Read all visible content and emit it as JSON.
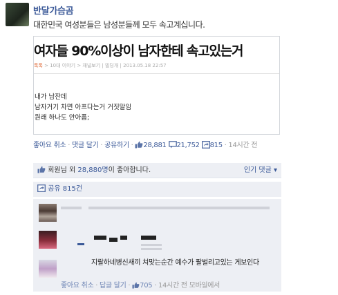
{
  "post": {
    "author": "반달가슴곰",
    "text": "대한민국 여성분들은 남성분들께 모두 속고계십니다."
  },
  "shared": {
    "headline": "여자들 90%이상이 남자한테 속고있는거",
    "crumb": [
      "톡톡",
      " > 10대 이야기 > ",
      "채널보기",
      " | 빌딩개 | 2013.05.18 22:57"
    ],
    "body": [
      "내가 남잔데",
      "남자거기 차면 아프다는거 거짓말임",
      "원래 하나도 안아픔;"
    ]
  },
  "actions": {
    "like": "좋아요 취소",
    "sep": " · ",
    "comment": "댓글 달기",
    "share": "공유하기",
    "likes_count": "28,881",
    "comments_count": "21,752",
    "shares_count": "815",
    "time": "14시간 전"
  },
  "likes_box": {
    "text_pre": "회원님 외 ",
    "count_link": "28,880명",
    "text_post": "이 좋아합니다.",
    "popular": "인기 댓글 ▾"
  },
  "shares_box": {
    "label": "공유 815건"
  },
  "comment3": {
    "text": "지랄하네병신새끼 쳐맞는순간 예수가 팔벌리고있는 게보인다",
    "like": "좋아요 취소",
    "reply": "답글 달기",
    "likes": "705",
    "time": "14시간 전 모바일에서"
  },
  "colors": {
    "link": "#3b5998",
    "panel": "#edeff4",
    "muted": "#999999"
  },
  "icons": [
    "thumbs-up-icon",
    "comment-icon",
    "share-icon",
    "popular-sort-icon"
  ]
}
